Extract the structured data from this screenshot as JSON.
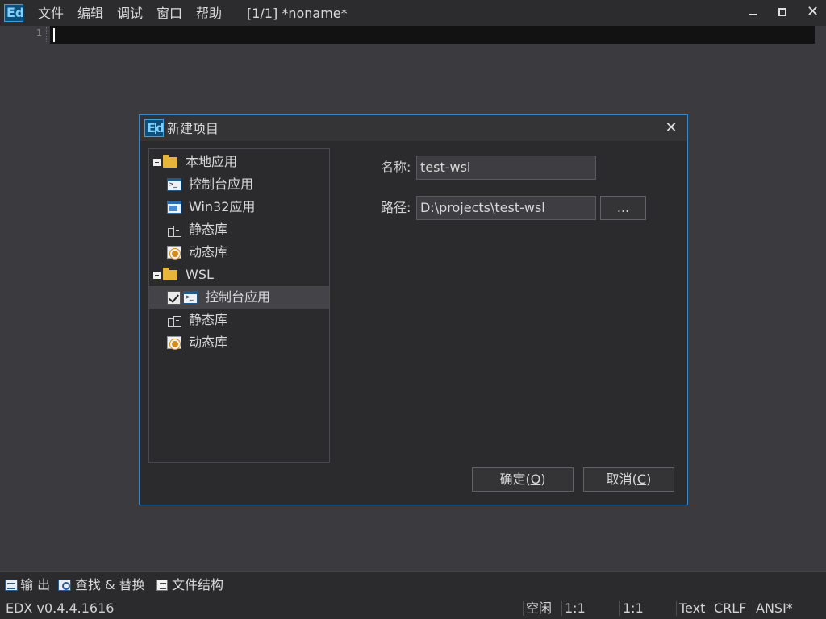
{
  "menu": [
    "文件",
    "编辑",
    "调试",
    "窗口",
    "帮助"
  ],
  "doc_title": "[1/1] *noname*",
  "window_controls": {
    "minimize": "minimize-icon",
    "maximize": "maximize-icon",
    "close": "✕"
  },
  "editor": {
    "line_number": "1"
  },
  "dialog": {
    "title": "新建项目",
    "close": "✕",
    "tree": [
      {
        "label": "本地应用",
        "icon": "folder-icon",
        "expanded": true,
        "level": 0
      },
      {
        "label": "控制台应用",
        "icon": "console-icon",
        "level": 1
      },
      {
        "label": "Win32应用",
        "icon": "window-app-icon",
        "level": 1
      },
      {
        "label": "静态库",
        "icon": "static-library-icon",
        "level": 1
      },
      {
        "label": "动态库",
        "icon": "dynamic-library-icon",
        "level": 1
      },
      {
        "label": "WSL",
        "icon": "folder-icon",
        "expanded": true,
        "level": 0
      },
      {
        "label": "控制台应用",
        "icon": "console-icon",
        "level": 1,
        "selected": true,
        "checked": true
      },
      {
        "label": "静态库",
        "icon": "static-library-icon",
        "level": 1
      },
      {
        "label": "动态库",
        "icon": "dynamic-library-icon",
        "level": 1
      }
    ],
    "name_label": "名称:",
    "name_value": "test-wsl",
    "path_label": "路径:",
    "path_value": "D:\\projects\\test-wsl",
    "browse_label": "...",
    "ok_text": "确定(",
    "ok_key": "O",
    "ok_end": ")",
    "cancel_text": "取消(",
    "cancel_key": "C",
    "cancel_end": ")"
  },
  "panels": {
    "output": "输 出",
    "find": "查找 & 替换",
    "structure": "文件结构"
  },
  "status": {
    "version": "EDX v0.4.4.1616",
    "state": "空闲",
    "pos1": "1:1",
    "pos2": "1:1",
    "mode": "Text",
    "eol": "CRLF",
    "encoding": "ANSI*"
  },
  "colors": {
    "accent_border": "#3d86c6",
    "background": "#3a3a3f",
    "panel": "#2b2b2e"
  }
}
